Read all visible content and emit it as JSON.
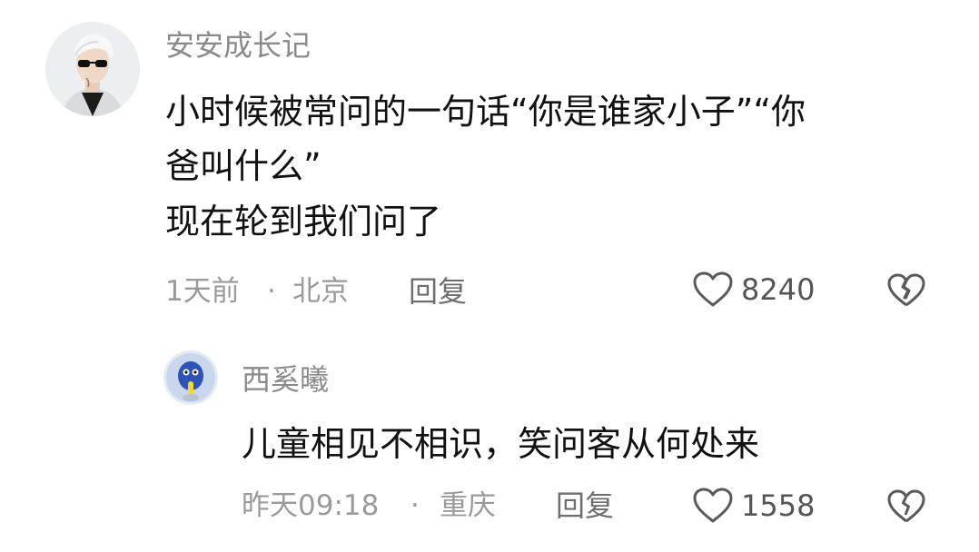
{
  "comment": {
    "username": "安安成长记",
    "lines": [
      "小时候被常问的一句话“你是谁家小子”“你",
      "爸叫什么”",
      "现在轮到我们问了"
    ],
    "time": "1天前",
    "separator": "·",
    "location": "北京",
    "reply_label": "回复",
    "like_count": "8240",
    "icons": {
      "like": "heart-outline-icon",
      "dislike": "broken-heart-icon"
    }
  },
  "reply": {
    "username": "西奚曦",
    "text": "儿童相见不相识，笑问客从何处来",
    "time": "昨天09:18",
    "separator": "·",
    "location": "重庆",
    "reply_label": "回复",
    "like_count": "1558",
    "icons": {
      "like": "heart-outline-icon",
      "dislike": "broken-heart-icon"
    }
  },
  "colors": {
    "username": "#8a8a8a",
    "body": "#111111",
    "meta": "#9a9a9a",
    "icon": "#5a5a5a"
  }
}
